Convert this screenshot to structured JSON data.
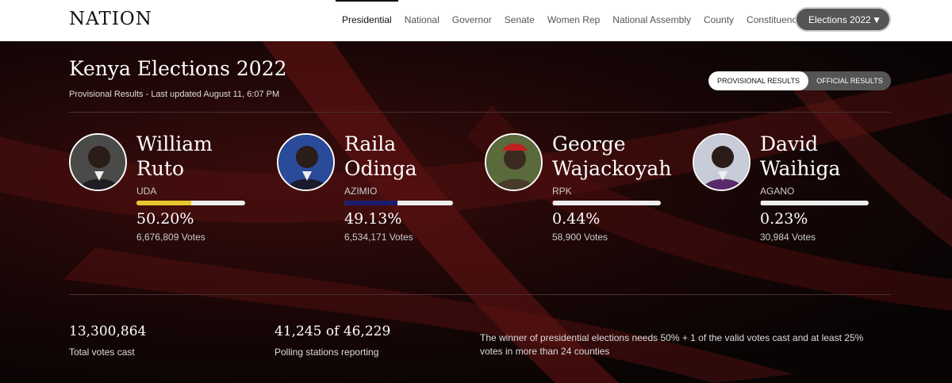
{
  "nav": {
    "logo": "NATION",
    "tabs": [
      "Presidential",
      "National",
      "Governor",
      "Senate",
      "Women Rep",
      "National Assembly",
      "County",
      "Constituency"
    ],
    "active_tab": "Presidential",
    "elections_button": "Elections 2022"
  },
  "hero": {
    "title": "Kenya Elections 2022",
    "subtitle": "Provisional Results - Last updated August 11, 6:07 PM",
    "toggle": {
      "provisional": "PROVISIONAL RESULTS",
      "official": "OFFICIAL RESULTS",
      "selected": "provisional"
    }
  },
  "candidates": [
    {
      "first": "William",
      "last": "Ruto",
      "party": "UDA",
      "pct": "50.20%",
      "pct_value": 50.2,
      "votes": "6,676,809 Votes",
      "color": "#e8c62e"
    },
    {
      "first": "Raila",
      "last": "Odinga",
      "party": "AZIMIO",
      "pct": "49.13%",
      "pct_value": 49.13,
      "votes": "6,534,171 Votes",
      "color": "#1c1c6e"
    },
    {
      "first": "George",
      "last": "Wajackoyah",
      "party": "RPK",
      "pct": "0.44%",
      "pct_value": 0.44,
      "votes": "58,900 Votes",
      "color": "#b02020"
    },
    {
      "first": "David",
      "last": "Waihiga",
      "party": "AGANO",
      "pct": "0.23%",
      "pct_value": 0.23,
      "votes": "30,984 Votes",
      "color": "#333333"
    }
  ],
  "stats": {
    "total_votes": "13,300,864",
    "total_votes_label": "Total votes cast",
    "stations": "41,245 of 46,229",
    "stations_label": "Polling stations reporting",
    "note": "The winner of presidential elections needs 50% + 1 of the valid votes cast and at least 25% votes in more than 24 counties"
  }
}
